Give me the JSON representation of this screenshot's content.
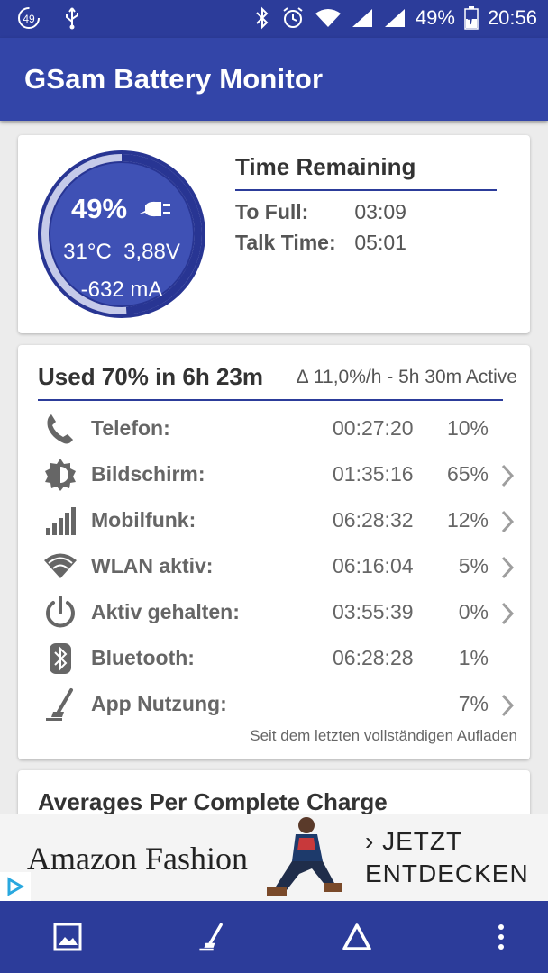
{
  "status_bar": {
    "notification_badge": "49",
    "icons": [
      "usb-icon",
      "bluetooth-icon",
      "alarm-icon",
      "wifi-icon",
      "signal-icon",
      "signal-icon",
      "battery-icon"
    ],
    "battery": "49%",
    "time": "20:56"
  },
  "app_bar": {
    "title": "GSam Battery Monitor"
  },
  "battery_gauge": {
    "percent": "49%",
    "level": 0.49,
    "temp": "31°C",
    "voltage": "3,88V",
    "current": "-632 mA",
    "colors": {
      "fill": "#3f51b5",
      "ring_bg": "#c5cae9",
      "ring_fg": "#283593"
    }
  },
  "time_remaining": {
    "title": "Time Remaining",
    "rows": [
      {
        "label": "To Full:",
        "value": "03:09"
      },
      {
        "label": "Talk Time:",
        "value": "05:01"
      }
    ]
  },
  "usage": {
    "title": "Used 70% in 6h 23m",
    "delta": "∆ 11,0%/h - 5h 30m Active",
    "rows": [
      {
        "icon": "phone-icon",
        "name": "Telefon:",
        "time": "00:27:20",
        "percent": "10%",
        "chevron": false
      },
      {
        "icon": "brightness-icon",
        "name": "Bildschirm:",
        "time": "01:35:16",
        "percent": "65%",
        "chevron": true
      },
      {
        "icon": "cell-signal-icon",
        "name": "Mobilfunk:",
        "time": "06:28:32",
        "percent": "12%",
        "chevron": true
      },
      {
        "icon": "wifi-icon",
        "name": "WLAN aktiv:",
        "time": "06:16:04",
        "percent": "5%",
        "chevron": true
      },
      {
        "icon": "power-icon",
        "name": "Aktiv gehalten:",
        "time": "03:55:39",
        "percent": "0%",
        "chevron": true
      },
      {
        "icon": "bluetooth-icon",
        "name": "Bluetooth:",
        "time": "06:28:28",
        "percent": "1%",
        "chevron": false
      },
      {
        "icon": "app-usage-icon",
        "name": "App Nutzung:",
        "time": "",
        "percent": "7%",
        "chevron": true
      }
    ],
    "footnote": "Seit dem letzten vollständigen Aufladen"
  },
  "averages": {
    "title": "Averages Per Complete Charge"
  },
  "ad": {
    "brand": "Amazon Fashion",
    "cta_line1": "› JETZT",
    "cta_line2": "ENTDECKEN"
  },
  "bottom_bar": {
    "buttons": [
      "image-icon",
      "app-usage-icon",
      "triangle-icon",
      "more-vert-icon"
    ]
  }
}
